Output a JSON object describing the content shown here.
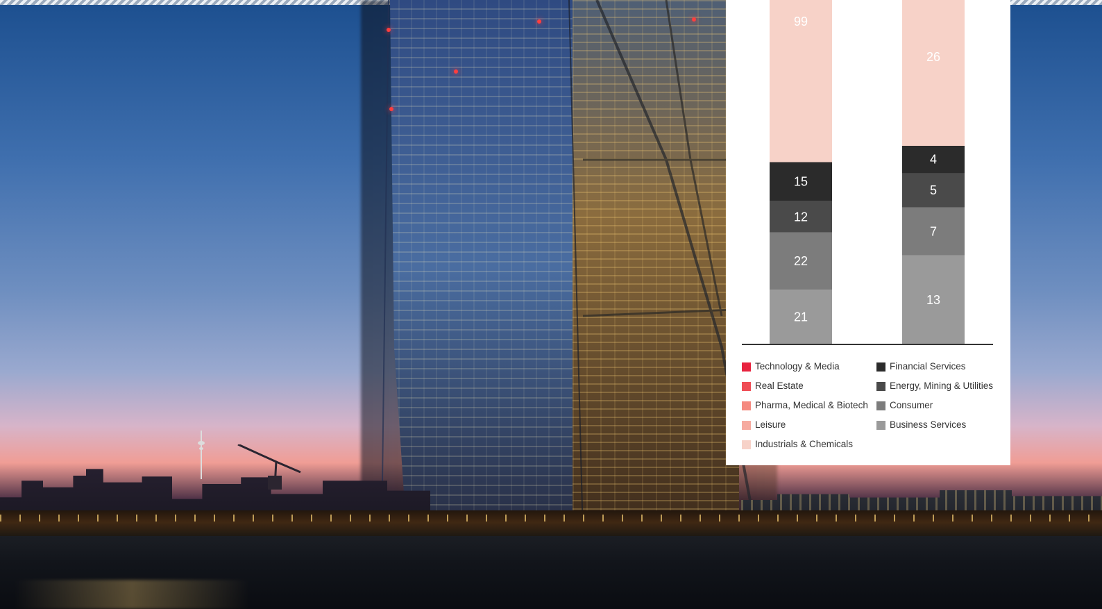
{
  "chart_data": {
    "type": "bar",
    "stacked": true,
    "orientation": "vertical",
    "title": "",
    "xlabel": "",
    "ylabel": "",
    "categories": [
      "",
      ""
    ],
    "series": [
      {
        "name": "Business Services",
        "color": "#9a9a9a",
        "values": [
          21,
          13
        ]
      },
      {
        "name": "Consumer",
        "color": "#7c7c7c",
        "values": [
          22,
          7
        ]
      },
      {
        "name": "Energy, Mining & Utilities",
        "color": "#4a4a4a",
        "values": [
          12,
          5
        ]
      },
      {
        "name": "Financial Services",
        "color": "#2b2b2b",
        "values": [
          15,
          4
        ]
      },
      {
        "name": "Industrials & Chemicals",
        "color": "#f7d2c8",
        "values": [
          99,
          26
        ]
      }
    ],
    "legend": {
      "placement": "bottom",
      "items_left": [
        {
          "label": "Technology & Media",
          "color": "#e8233f"
        },
        {
          "label": "Real Estate",
          "color": "#ef4d55"
        },
        {
          "label": "Pharma, Medical & Biotech",
          "color": "#f58a80"
        },
        {
          "label": "Leisure",
          "color": "#f6aa9f"
        },
        {
          "label": "Industrials & Chemicals",
          "color": "#f7d2c8"
        }
      ],
      "items_right": [
        {
          "label": "Financial Services",
          "color": "#2b2b2b"
        },
        {
          "label": "Energy, Mining & Utilities",
          "color": "#4a4a4a"
        },
        {
          "label": "Consumer",
          "color": "#7c7c7c"
        },
        {
          "label": "Business Services",
          "color": "#9a9a9a"
        }
      ]
    }
  },
  "background": {
    "description_colors": {
      "sky_top": "#1c4f8f",
      "sky_bottom": "#f09d95",
      "ground": "#0b0f17"
    }
  }
}
